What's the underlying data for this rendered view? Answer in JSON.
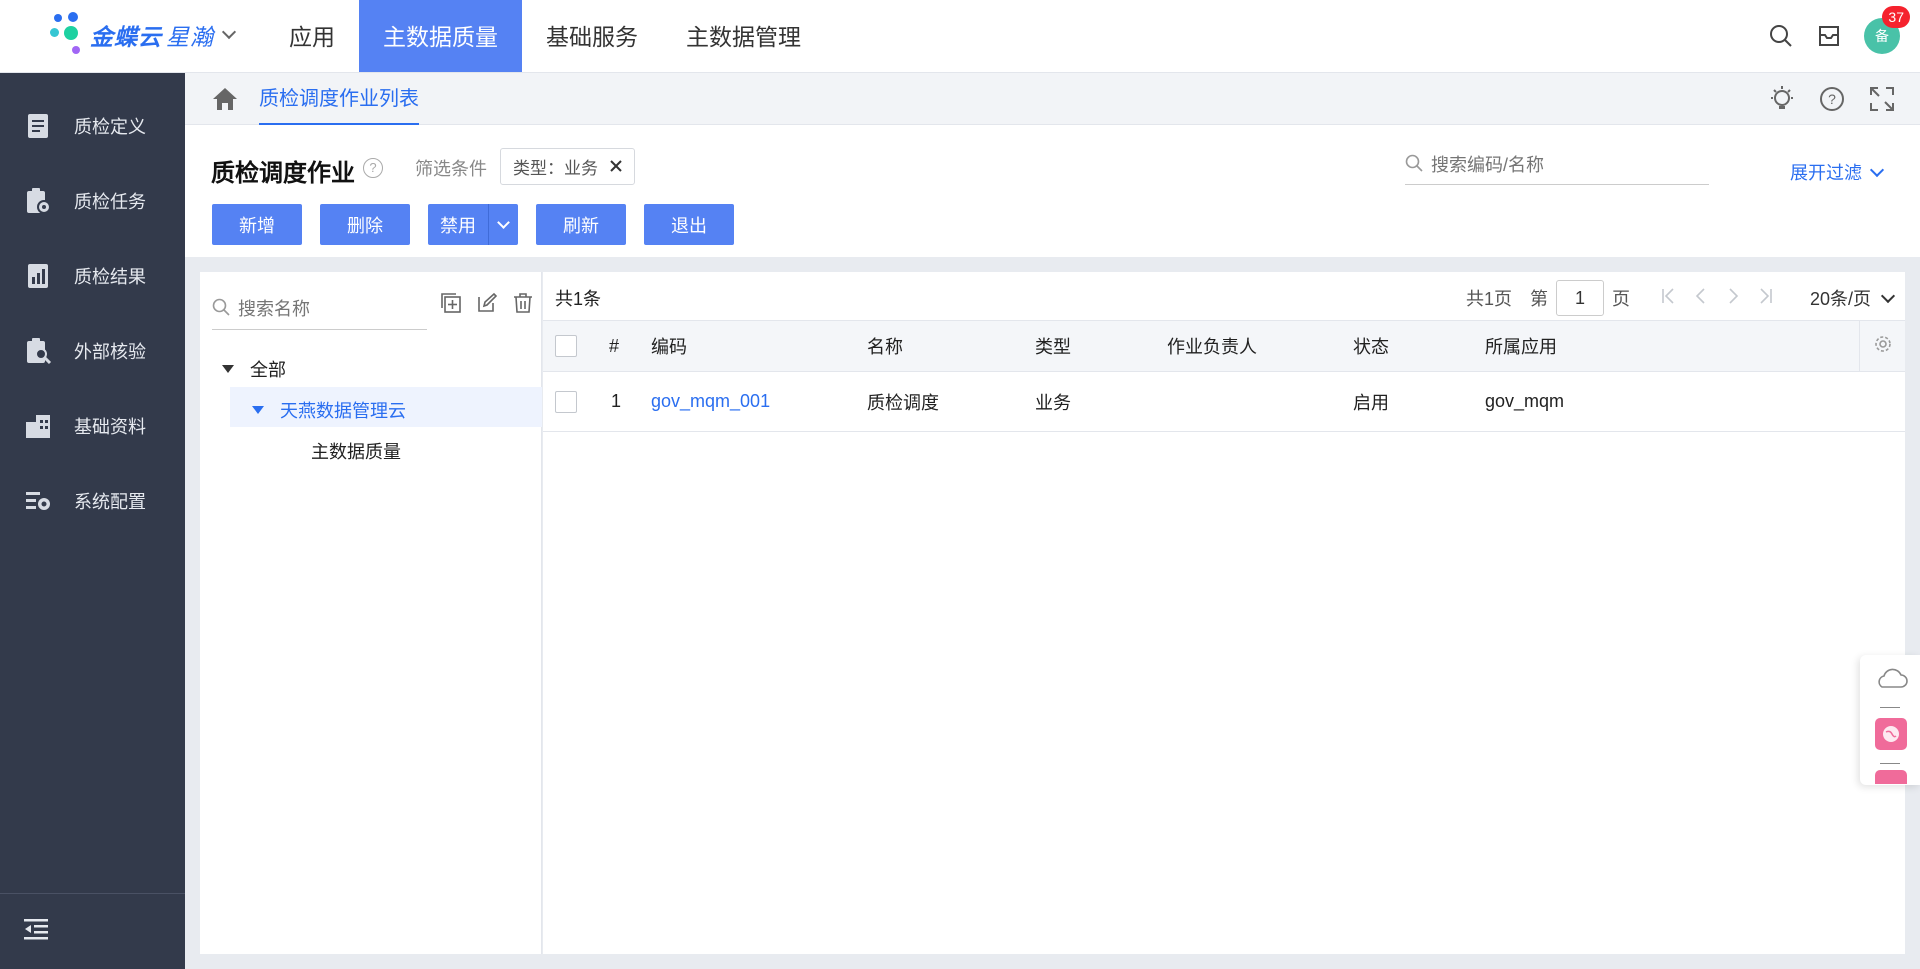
{
  "brand": {
    "name": "金蝶云",
    "sub": "星瀚"
  },
  "topnav": [
    {
      "label": "应用",
      "active": false
    },
    {
      "label": "主数据质量",
      "active": true
    },
    {
      "label": "基础服务",
      "active": false
    },
    {
      "label": "主数据管理",
      "active": false
    }
  ],
  "user": {
    "avatar_text": "备",
    "badge_count": "37"
  },
  "sidebar": {
    "items": [
      {
        "label": "质检定义",
        "icon": "document-icon"
      },
      {
        "label": "质检任务",
        "icon": "task-gear-icon"
      },
      {
        "label": "质检结果",
        "icon": "report-icon"
      },
      {
        "label": "外部核验",
        "icon": "clipboard-search-icon"
      },
      {
        "label": "基础资料",
        "icon": "building-icon"
      },
      {
        "label": "系统配置",
        "icon": "settings-panel-icon"
      }
    ]
  },
  "breadcrumb": {
    "tab": "质检调度作业列表"
  },
  "page": {
    "title": "质检调度作业",
    "filter_label": "筛选条件",
    "filter_tag": "类型：业务",
    "search_placeholder": "搜索编码/名称",
    "expand_filter": "展开过滤"
  },
  "toolbar": {
    "add": "新增",
    "delete": "删除",
    "disable": "禁用",
    "refresh": "刷新",
    "exit": "退出"
  },
  "tree": {
    "search_placeholder": "搜索名称",
    "nodes": [
      {
        "label": "全部"
      },
      {
        "label": "天燕数据管理云"
      },
      {
        "label": "主数据质量"
      }
    ]
  },
  "grid": {
    "total": "共1条",
    "pager": {
      "pages": "共1页",
      "page_prefix": "第",
      "page": "1",
      "page_suffix": "页",
      "page_size": "20条/页"
    },
    "columns": [
      "#",
      "编码",
      "名称",
      "类型",
      "作业负责人",
      "状态",
      "所属应用"
    ],
    "rows": [
      {
        "index": "1",
        "code": "gov_mqm_001",
        "name": "质检调度",
        "type": "业务",
        "owner": "",
        "status": "启用",
        "app": "gov_mqm"
      }
    ]
  },
  "colors": {
    "primary": "#5582f3",
    "link": "#2a6ef0",
    "sidebar_bg": "#333a4b",
    "badge": "#f5222d"
  }
}
